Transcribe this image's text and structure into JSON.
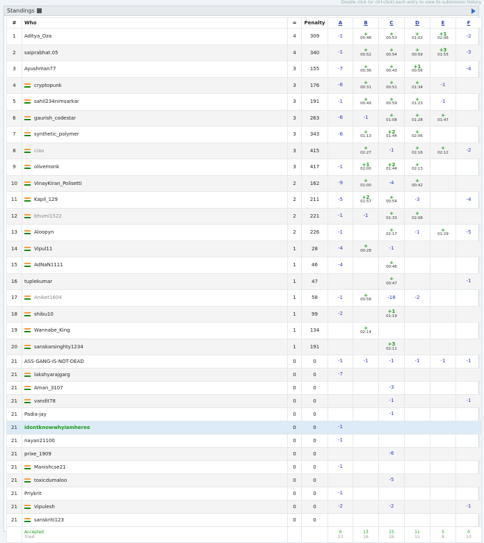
{
  "hint": "Double click (or ctrl-click) each entry to view its submission history",
  "panel_title": "Standings",
  "columns": {
    "rank": "#",
    "who": "Who",
    "solved": "=",
    "penalty": "Penalty"
  },
  "problems": [
    "A",
    "B",
    "C",
    "D",
    "E",
    "F"
  ],
  "rows": [
    {
      "rank": "1",
      "name": "Aditya_Oza",
      "flag": false,
      "style": "",
      "solved": "4",
      "penalty": "309",
      "cells": [
        [
          "-1",
          ""
        ],
        [
          "+",
          "00:48"
        ],
        [
          "+",
          "00:53"
        ],
        [
          "+",
          "01:02"
        ],
        [
          "+1",
          "02:06"
        ],
        [
          "-2",
          ""
        ]
      ]
    },
    {
      "rank": "2",
      "name": "saiprabhat.05",
      "flag": false,
      "style": "",
      "solved": "4",
      "penalty": "340",
      "cells": [
        [
          "-1",
          ""
        ],
        [
          "+",
          "00:52"
        ],
        [
          "+",
          "00:54"
        ],
        [
          "+",
          "00:59"
        ],
        [
          "+3",
          "01:55"
        ],
        [
          "-3",
          ""
        ]
      ]
    },
    {
      "rank": "3",
      "name": "Ayushman77",
      "flag": false,
      "style": "",
      "solved": "3",
      "penalty": "155",
      "cells": [
        [
          "-7",
          ""
        ],
        [
          "+",
          "00:36"
        ],
        [
          "+",
          "00:43"
        ],
        [
          "+1",
          "00:56"
        ],
        [
          "",
          ""
        ],
        [
          "-4",
          ""
        ]
      ]
    },
    {
      "rank": "4",
      "name": "cryptopunk",
      "flag": true,
      "style": "",
      "solved": "3",
      "penalty": "176",
      "cells": [
        [
          "-8",
          ""
        ],
        [
          "+",
          "00:31"
        ],
        [
          "+",
          "00:51"
        ],
        [
          "+",
          "01:34"
        ],
        [
          "-1",
          ""
        ],
        [
          "",
          ""
        ]
      ]
    },
    {
      "rank": "5",
      "name": "sahil234nimsarkar",
      "flag": true,
      "style": "",
      "solved": "3",
      "penalty": "191",
      "cells": [
        [
          "-1",
          ""
        ],
        [
          "+",
          "00:49"
        ],
        [
          "+",
          "00:59"
        ],
        [
          "+",
          "01:23"
        ],
        [
          "-1",
          ""
        ],
        [
          "",
          ""
        ]
      ]
    },
    {
      "rank": "6",
      "name": "gaurish_codestar",
      "flag": true,
      "style": "",
      "solved": "3",
      "penalty": "263",
      "cells": [
        [
          "-6",
          ""
        ],
        [
          "-1",
          ""
        ],
        [
          "+",
          "01:08"
        ],
        [
          "+",
          "01:28"
        ],
        [
          "+",
          "01:47"
        ],
        [
          "",
          ""
        ]
      ]
    },
    {
      "rank": "7",
      "name": "synthetic_polymer",
      "flag": true,
      "style": "",
      "solved": "3",
      "penalty": "343",
      "cells": [
        [
          "-6",
          ""
        ],
        [
          "+",
          "01:13"
        ],
        [
          "+2",
          "01:44"
        ],
        [
          "+",
          "02:06"
        ],
        [
          "",
          ""
        ],
        [
          "",
          ""
        ]
      ]
    },
    {
      "rank": "8",
      "name": "ciao",
      "flag": true,
      "style": "gray",
      "solved": "3",
      "penalty": "415",
      "cells": [
        [
          "",
          ""
        ],
        [
          "+",
          "02:27"
        ],
        [
          "-1",
          ""
        ],
        [
          "+",
          "02:16"
        ],
        [
          "+",
          "02:12"
        ],
        [
          "-2",
          ""
        ]
      ]
    },
    {
      "rank": "9",
      "name": "olivemonk",
      "flag": true,
      "style": "",
      "solved": "3",
      "penalty": "417",
      "cells": [
        [
          "-1",
          ""
        ],
        [
          "+1",
          "02:00"
        ],
        [
          "+2",
          "01:44"
        ],
        [
          "+",
          "02:13"
        ],
        [
          "",
          ""
        ],
        [
          "",
          ""
        ]
      ]
    },
    {
      "rank": "10",
      "name": "VinayKiran_Polisetti",
      "flag": true,
      "style": "",
      "solved": "2",
      "penalty": "162",
      "cells": [
        [
          "-9",
          ""
        ],
        [
          "+",
          "01:00"
        ],
        [
          "-4",
          ""
        ],
        [
          "+",
          "00:42"
        ],
        [
          "",
          ""
        ],
        [
          "",
          ""
        ]
      ]
    },
    {
      "rank": "11",
      "name": "Kapil_129",
      "flag": true,
      "style": "",
      "solved": "2",
      "penalty": "211",
      "cells": [
        [
          "-5",
          ""
        ],
        [
          "+2",
          "01:57"
        ],
        [
          "+",
          "00:54"
        ],
        [
          "-3",
          ""
        ],
        [
          "",
          ""
        ],
        [
          "-4",
          ""
        ]
      ]
    },
    {
      "rank": "12",
      "name": "bhumi1522",
      "flag": true,
      "style": "gray",
      "solved": "2",
      "penalty": "221",
      "cells": [
        [
          "-1",
          ""
        ],
        [
          "-1",
          ""
        ],
        [
          "+",
          "01:33"
        ],
        [
          "+",
          "02:08"
        ],
        [
          "",
          ""
        ],
        [
          "",
          ""
        ]
      ]
    },
    {
      "rank": "13",
      "name": "Aloopyn",
      "flag": true,
      "style": "",
      "solved": "2",
      "penalty": "226",
      "cells": [
        [
          "-1",
          ""
        ],
        [
          "",
          ""
        ],
        [
          "+",
          "02:17"
        ],
        [
          "-1",
          ""
        ],
        [
          "+",
          "01:29"
        ],
        [
          "-5",
          ""
        ]
      ]
    },
    {
      "rank": "14",
      "name": "Vipul11",
      "flag": true,
      "style": "",
      "solved": "1",
      "penalty": "28",
      "cells": [
        [
          "-4",
          ""
        ],
        [
          "+",
          "00:28"
        ],
        [
          "-1",
          ""
        ],
        [
          "",
          ""
        ],
        [
          "",
          ""
        ],
        [
          "",
          ""
        ]
      ]
    },
    {
      "rank": "15",
      "name": "AdNaN1111",
      "flag": true,
      "style": "",
      "solved": "1",
      "penalty": "46",
      "cells": [
        [
          "-4",
          ""
        ],
        [
          "",
          ""
        ],
        [
          "+",
          "00:46"
        ],
        [
          "",
          ""
        ],
        [
          "",
          ""
        ],
        [
          "",
          ""
        ]
      ]
    },
    {
      "rank": "16",
      "name": "tuplekumar",
      "flag": false,
      "style": "",
      "solved": "1",
      "penalty": "47",
      "cells": [
        [
          "",
          ""
        ],
        [
          "",
          ""
        ],
        [
          "+",
          "00:47"
        ],
        [
          "",
          ""
        ],
        [
          "",
          ""
        ],
        [
          "-1",
          ""
        ]
      ]
    },
    {
      "rank": "17",
      "name": "Aniket1604",
      "flag": true,
      "style": "gray",
      "solved": "1",
      "penalty": "58",
      "cells": [
        [
          "-1",
          ""
        ],
        [
          "+",
          "00:58"
        ],
        [
          "-18",
          ""
        ],
        [
          "-2",
          ""
        ],
        [
          "",
          ""
        ],
        [
          "",
          ""
        ]
      ]
    },
    {
      "rank": "18",
      "name": "shibu10",
      "flag": true,
      "style": "",
      "solved": "1",
      "penalty": "99",
      "cells": [
        [
          "-2",
          ""
        ],
        [
          "",
          ""
        ],
        [
          "+1",
          "01:19"
        ],
        [
          "",
          ""
        ],
        [
          "",
          ""
        ],
        [
          "",
          ""
        ]
      ]
    },
    {
      "rank": "19",
      "name": "Wannabe_King",
      "flag": true,
      "style": "",
      "solved": "1",
      "penalty": "134",
      "cells": [
        [
          "",
          ""
        ],
        [
          "+",
          "02:14"
        ],
        [
          "",
          ""
        ],
        [
          "",
          ""
        ],
        [
          "",
          ""
        ],
        [
          "",
          ""
        ]
      ]
    },
    {
      "rank": "20",
      "name": "sanskarsinghty1234",
      "flag": true,
      "style": "",
      "solved": "1",
      "penalty": "191",
      "cells": [
        [
          "",
          ""
        ],
        [
          "",
          ""
        ],
        [
          "+3",
          "02:11"
        ],
        [
          "",
          ""
        ],
        [
          "",
          ""
        ],
        [
          "",
          ""
        ]
      ]
    },
    {
      "rank": "21",
      "name": "ASS-GANG-IS-NOT-DEAD",
      "flag": false,
      "style": "",
      "solved": "0",
      "penalty": "0",
      "cells": [
        [
          "-1",
          ""
        ],
        [
          "-1",
          ""
        ],
        [
          "-1",
          ""
        ],
        [
          "-1",
          ""
        ],
        [
          "-1",
          ""
        ],
        [
          "-1",
          ""
        ]
      ]
    },
    {
      "rank": "21",
      "name": "lakshyarajgarg",
      "flag": true,
      "style": "",
      "solved": "0",
      "penalty": "0",
      "cells": [
        [
          "-7",
          ""
        ],
        [
          "",
          ""
        ],
        [
          "",
          ""
        ],
        [
          "",
          ""
        ],
        [
          "",
          ""
        ],
        [
          "",
          ""
        ]
      ]
    },
    {
      "rank": "21",
      "name": "Aman_3107",
      "flag": true,
      "style": "",
      "solved": "0",
      "penalty": "0",
      "cells": [
        [
          "",
          ""
        ],
        [
          "",
          ""
        ],
        [
          "-3",
          ""
        ],
        [
          "",
          ""
        ],
        [
          "",
          ""
        ],
        [
          "",
          ""
        ]
      ]
    },
    {
      "rank": "21",
      "name": "vandit78",
      "flag": true,
      "style": "",
      "solved": "0",
      "penalty": "0",
      "cells": [
        [
          "",
          ""
        ],
        [
          "",
          ""
        ],
        [
          "-1",
          ""
        ],
        [
          "",
          ""
        ],
        [
          "",
          ""
        ],
        [
          "-1",
          ""
        ]
      ]
    },
    {
      "rank": "21",
      "name": "Padia-jay",
      "flag": false,
      "style": "",
      "solved": "0",
      "penalty": "0",
      "cells": [
        [
          "",
          ""
        ],
        [
          "",
          ""
        ],
        [
          "-1",
          ""
        ],
        [
          "",
          ""
        ],
        [
          "",
          ""
        ],
        [
          "",
          ""
        ]
      ]
    },
    {
      "rank": "21",
      "name": "idontknowwhyiamheree",
      "flag": false,
      "style": "green",
      "solved": "0",
      "penalty": "0",
      "cells": [
        [
          "-1",
          ""
        ],
        [
          "",
          ""
        ],
        [
          "",
          ""
        ],
        [
          "",
          ""
        ],
        [
          "",
          ""
        ],
        [
          "",
          ""
        ]
      ]
    },
    {
      "rank": "21",
      "name": "nayan21100",
      "flag": false,
      "style": "",
      "solved": "0",
      "penalty": "0",
      "cells": [
        [
          "-1",
          ""
        ],
        [
          "",
          ""
        ],
        [
          "",
          ""
        ],
        [
          "",
          ""
        ],
        [
          "",
          ""
        ],
        [
          "",
          ""
        ]
      ]
    },
    {
      "rank": "21",
      "name": "prixe_1909",
      "flag": false,
      "style": "",
      "solved": "0",
      "penalty": "0",
      "cells": [
        [
          "",
          ""
        ],
        [
          "",
          ""
        ],
        [
          "-6",
          ""
        ],
        [
          "",
          ""
        ],
        [
          "",
          ""
        ],
        [
          "",
          ""
        ]
      ]
    },
    {
      "rank": "21",
      "name": "Manishcse21",
      "flag": true,
      "style": "",
      "solved": "0",
      "penalty": "0",
      "cells": [
        [
          "-1",
          ""
        ],
        [
          "",
          ""
        ],
        [
          "",
          ""
        ],
        [
          "",
          ""
        ],
        [
          "",
          ""
        ],
        [
          "",
          ""
        ]
      ]
    },
    {
      "rank": "21",
      "name": "toxicdumaloo",
      "flag": true,
      "style": "",
      "solved": "0",
      "penalty": "0",
      "cells": [
        [
          "",
          ""
        ],
        [
          "",
          ""
        ],
        [
          "-5",
          ""
        ],
        [
          "",
          ""
        ],
        [
          "",
          ""
        ],
        [
          "",
          ""
        ]
      ]
    },
    {
      "rank": "21",
      "name": "Priykrit",
      "flag": false,
      "style": "",
      "solved": "0",
      "penalty": "0",
      "cells": [
        [
          "-1",
          ""
        ],
        [
          "",
          ""
        ],
        [
          "",
          ""
        ],
        [
          "",
          ""
        ],
        [
          "",
          ""
        ],
        [
          "",
          ""
        ]
      ]
    },
    {
      "rank": "21",
      "name": "Vipulesh",
      "flag": true,
      "style": "",
      "solved": "0",
      "penalty": "0",
      "cells": [
        [
          "-2",
          ""
        ],
        [
          "",
          ""
        ],
        [
          "-2",
          ""
        ],
        [
          "",
          ""
        ],
        [
          "",
          ""
        ],
        [
          "-1",
          ""
        ]
      ]
    },
    {
      "rank": "21",
      "name": "sanskriti123",
      "flag": true,
      "style": "",
      "solved": "0",
      "penalty": "0",
      "cells": [
        [
          "",
          ""
        ],
        [
          "",
          ""
        ],
        [
          "",
          ""
        ],
        [
          "",
          ""
        ],
        [
          "",
          ""
        ],
        [
          "",
          ""
        ]
      ]
    }
  ],
  "footer": {
    "accepted_label": "Accepted",
    "tried_label": "Tried",
    "accepted": [
      "0",
      "13",
      "15",
      "11",
      "5",
      "0"
    ],
    "tried": [
      "23",
      "16",
      "26",
      "15",
      "8",
      "10"
    ]
  },
  "colors": {
    "accepted": "#1a9a1a",
    "rejected": "#2a3db4",
    "highlight_row": "#dcebf7"
  }
}
